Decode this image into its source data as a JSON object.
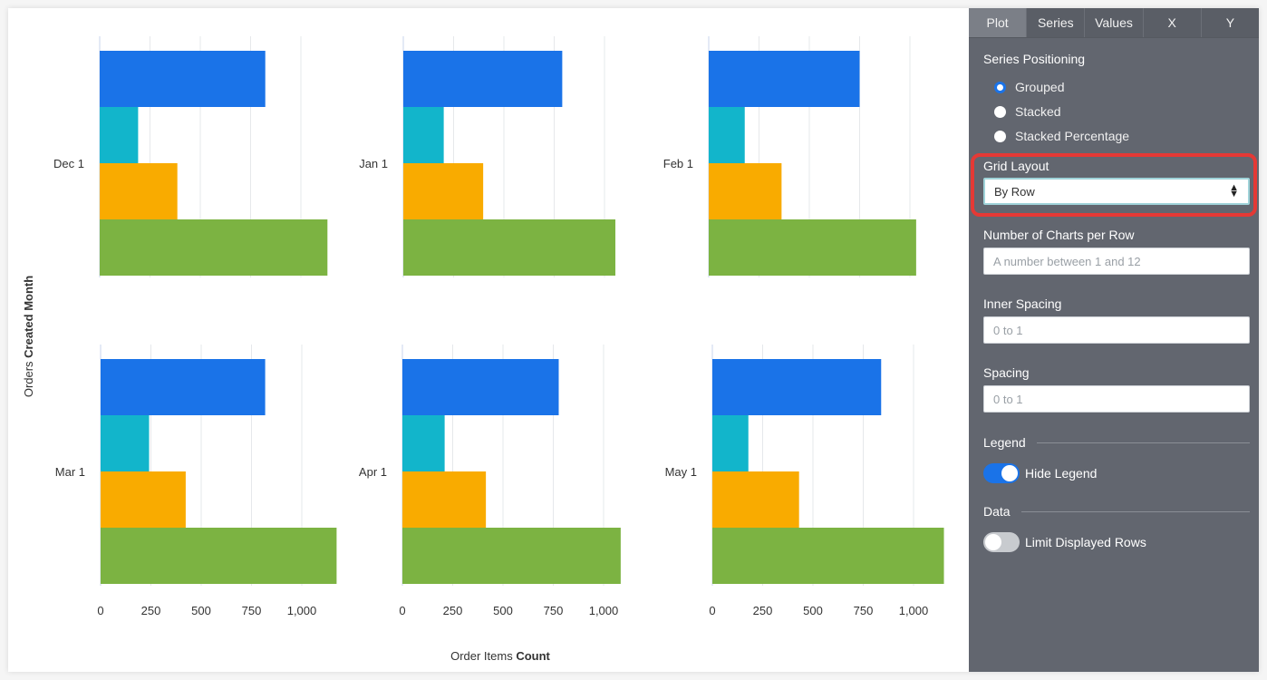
{
  "panel": {
    "tabs": [
      {
        "label": "Plot",
        "active": true
      },
      {
        "label": "Series",
        "active": false
      },
      {
        "label": "Values",
        "active": false
      },
      {
        "label": "X",
        "active": false
      },
      {
        "label": "Y",
        "active": false
      }
    ],
    "series_positioning": {
      "label": "Series Positioning",
      "options": [
        {
          "label": "Grouped",
          "checked": true
        },
        {
          "label": "Stacked",
          "checked": false
        },
        {
          "label": "Stacked Percentage",
          "checked": false
        }
      ]
    },
    "grid_layout": {
      "label": "Grid Layout",
      "value": "By Row",
      "highlighted": true,
      "highlight_color": "#e53935"
    },
    "charts_per_row": {
      "label": "Number of Charts per Row",
      "placeholder": "A number between 1 and 12",
      "value": ""
    },
    "inner_spacing": {
      "label": "Inner Spacing",
      "placeholder": "0 to 1",
      "value": ""
    },
    "spacing": {
      "label": "Spacing",
      "placeholder": "0 to 1",
      "value": ""
    },
    "legend": {
      "section": "Legend",
      "toggle_label": "Hide Legend",
      "on": true
    },
    "data": {
      "section": "Data",
      "toggle_label": "Limit Displayed Rows",
      "on": false
    }
  },
  "chart_data": {
    "type": "bar",
    "orientation": "horizontal",
    "layout": "small-multiples grid, 3 per row",
    "xlabel_prefix": "Order Items",
    "xlabel_bold": "Count",
    "ylabel_prefix": "Orders",
    "ylabel_bold": "Created Month",
    "xlim": [
      0,
      1200
    ],
    "xticks": [
      0,
      250,
      500,
      750,
      1000
    ],
    "xtick_labels": [
      "0",
      "250",
      "500",
      "750",
      "1,000"
    ],
    "grid": true,
    "legend": "hidden",
    "series_colors": [
      "#1a73e8",
      "#12b5cb",
      "#f9ab00",
      "#7cb342"
    ],
    "panels": [
      {
        "category": "Dec 1",
        "values": [
          823,
          191,
          386,
          1132
        ]
      },
      {
        "category": "Jan 1",
        "values": [
          790,
          201,
          397,
          1054
        ]
      },
      {
        "category": "Feb 1",
        "values": [
          750,
          179,
          362,
          1031
        ]
      },
      {
        "category": "Mar 1",
        "values": [
          818,
          241,
          423,
          1173
        ]
      },
      {
        "category": "Apr 1",
        "values": [
          777,
          210,
          415,
          1085
        ]
      },
      {
        "category": "May 1",
        "values": [
          839,
          179,
          431,
          1151
        ]
      }
    ]
  }
}
